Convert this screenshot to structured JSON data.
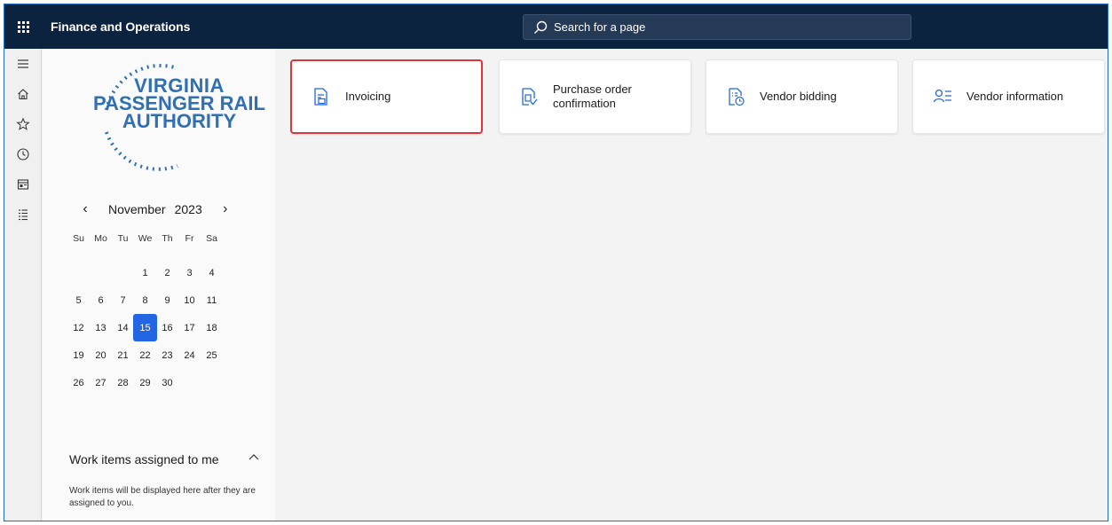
{
  "app": {
    "title": "Finance and Operations",
    "search_placeholder": "Search for a page"
  },
  "navpane": {
    "items": [
      {
        "icon": "hamburger-menu-icon"
      },
      {
        "icon": "home-icon"
      },
      {
        "icon": "star-icon"
      },
      {
        "icon": "clock-icon"
      },
      {
        "icon": "workspace-icon"
      },
      {
        "icon": "list-icon"
      }
    ]
  },
  "logo": {
    "line1": "VIRGINIA",
    "line2": "PASSENGER RAIL",
    "line3": "AUTHORITY"
  },
  "calendar": {
    "prev_glyph": "‹",
    "next_glyph": "›",
    "month": "November",
    "year": "2023",
    "weekdays": [
      "Su",
      "Mo",
      "Tu",
      "We",
      "Th",
      "Fr",
      "Sa"
    ],
    "leading_blanks": 3,
    "days": [
      "1",
      "2",
      "3",
      "4",
      "5",
      "6",
      "7",
      "8",
      "9",
      "10",
      "11",
      "12",
      "13",
      "14",
      "15",
      "16",
      "17",
      "18",
      "19",
      "20",
      "21",
      "22",
      "23",
      "24",
      "25",
      "26",
      "27",
      "28",
      "29",
      "30"
    ],
    "today": "15"
  },
  "work_items": {
    "title": "Work items assigned to me",
    "chevron": "^",
    "description": "Work items will be displayed here after they are assigned to you."
  },
  "tiles": [
    {
      "label": "Invoicing",
      "icon": "invoice-document-icon",
      "selected": true
    },
    {
      "label": "Purchase order confirmation",
      "icon": "purchase-order-icon",
      "selected": false
    },
    {
      "label": "Vendor bidding",
      "icon": "vendor-bidding-icon",
      "selected": false
    },
    {
      "label": "Vendor information",
      "icon": "vendor-information-icon",
      "selected": false
    }
  ],
  "colors": {
    "topbar": "#0c2340",
    "accent": "#2266e3",
    "tile_icon": "#2266e3",
    "highlight_border": "#d9373c",
    "logo_blue": "#2f6fb5"
  }
}
